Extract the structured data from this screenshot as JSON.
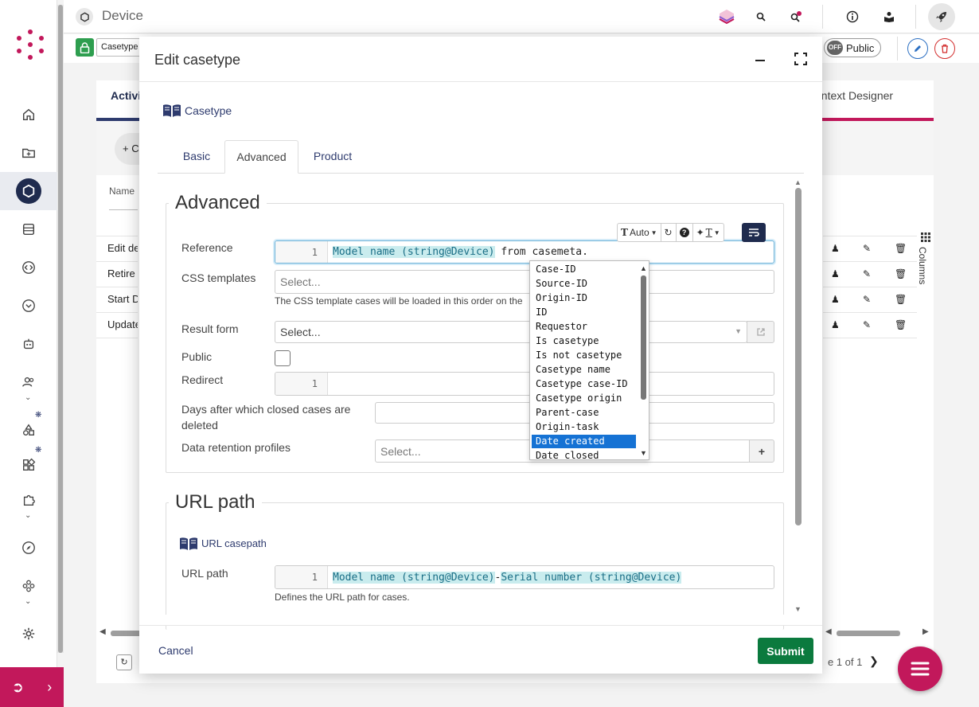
{
  "header": {
    "title": "Device"
  },
  "toolbar2": {
    "casetype_chip": "Casetype",
    "public_toggle_state": "OFF",
    "public_toggle_label": "Public"
  },
  "background": {
    "tab_activities": "Activi",
    "tab_context_designer": "ontext Designer",
    "add_button": "+ C",
    "column_name": "Name",
    "rows": [
      "Edit de",
      "Retire d",
      "Start D",
      "Update"
    ],
    "columns_label": "Columns",
    "pager_text": "e 1 of 1"
  },
  "modal": {
    "title": "Edit casetype",
    "casetype_link": "Casetype",
    "tabs": [
      {
        "label": "Basic"
      },
      {
        "label": "Advanced"
      },
      {
        "label": "Product"
      }
    ],
    "advanced": {
      "legend": "Advanced",
      "reference_label": "Reference",
      "reference_line": "1",
      "reference_token": "Model name (string@Device)",
      "reference_rest": " from casemeta.",
      "toolbar_auto": "Auto",
      "css_label": "CSS templates",
      "css_placeholder": "Select...",
      "css_help": "The CSS template cases will be loaded in this order on the",
      "result_form_label": "Result form",
      "result_form_placeholder": "Select...",
      "public_label": "Public",
      "redirect_label": "Redirect",
      "redirect_line": "1",
      "days_label": "Days after which closed cases are deleted",
      "retention_label": "Data retention profiles",
      "retention_placeholder": "Select..."
    },
    "autocomplete": {
      "items": [
        "Case-ID",
        "Source-ID",
        "Origin-ID",
        "ID",
        "Requestor",
        "Is casetype",
        "Is not casetype",
        "Casetype name",
        "Casetype case-ID",
        "Casetype origin",
        "Parent-case",
        "Origin-task",
        "Date created",
        "Date closed"
      ],
      "selected": "Date created"
    },
    "url": {
      "legend": "URL path",
      "casepath_link": "URL casepath",
      "path_label": "URL path",
      "line": "1",
      "token1": "Model name (string@Device)",
      "separator": "-",
      "token2": "Serial number (string@Device)",
      "help": "Defines the URL path for cases."
    },
    "cancel_label": "Cancel",
    "submit_label": "Submit"
  },
  "colors": {
    "brand": "#c2185b",
    "navy": "#1f2b4e",
    "submit": "#0b7a3e",
    "selected": "#1572d4",
    "token_bg": "#c9ecee"
  }
}
